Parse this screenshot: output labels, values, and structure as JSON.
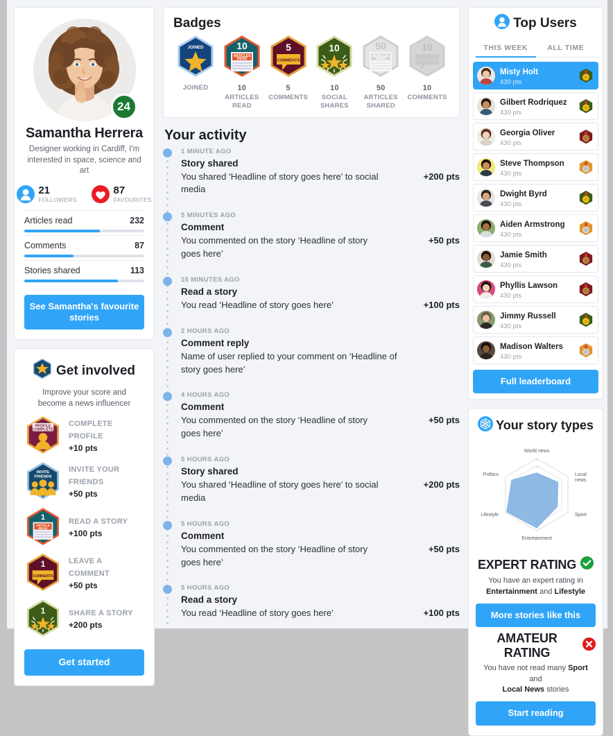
{
  "profile": {
    "name": "Samantha Herrera",
    "bio": "Designer working in Cardiff, I'm interested in space, science and art",
    "level": "24",
    "followers_count": "21",
    "followers_label": "FOLLOWERS",
    "favourites_count": "87",
    "favourites_label": "FAVOURITES",
    "bars": [
      {
        "label": "Articles read",
        "value": "232",
        "percent": 63
      },
      {
        "label": "Comments",
        "value": "87",
        "percent": 41
      },
      {
        "label": "Stories shared",
        "value": "113",
        "percent": 78
      }
    ],
    "cta": "See Samantha's favourite stories"
  },
  "get_involved": {
    "title": "Get involved",
    "subtitle": "Improve your score and become a news influencer",
    "items": [
      {
        "name": "COMPLETE PROFILE",
        "points": "+10 pts",
        "icon": "profile-complete-hex-icon",
        "color": "#7d1c42",
        "border": "#e8a33d",
        "chip": "PROFILE COMPLETE"
      },
      {
        "name": "INVITE YOUR FRIENDS",
        "points": "+50 pts",
        "icon": "invite-friends-hex-icon",
        "color": "#17486e",
        "border": "#9dc4e0",
        "chip": "INVITE FRIENDS"
      },
      {
        "name": "READ A STORY",
        "points": "+100 pts",
        "icon": "read-story-hex-icon",
        "color": "#15616b",
        "border": "#e2592e",
        "chip": "1"
      },
      {
        "name": "LEAVE A COMMENT",
        "points": "+50 pts",
        "icon": "comment-hex-icon",
        "color": "#5e1028",
        "border": "#e8a33d",
        "chip": "1"
      },
      {
        "name": "SHARE A STORY",
        "points": "+200 pts",
        "icon": "share-story-hex-icon",
        "color": "#3c5c18",
        "border": "#d4dba1",
        "chip": "1"
      }
    ],
    "cta": "Get started"
  },
  "badges": {
    "title": "Badges",
    "items": [
      {
        "icon": "joined-star-hex-icon",
        "number": "",
        "caption": "JOINED",
        "fill": "#14447c",
        "border": "#a9cdf0",
        "earned": true,
        "chip": "JOINED"
      },
      {
        "icon": "articles-read-hex-icon",
        "number": "10",
        "caption": "ARTICLES READ",
        "fill": "#15616b",
        "border": "#e2592e",
        "earned": true,
        "chip": "ARTICLES READ"
      },
      {
        "icon": "comments-hex-icon",
        "number": "5",
        "caption": "COMMENTS",
        "fill": "#5e1028",
        "border": "#e8a33d",
        "earned": true,
        "chip": "COMMENTS"
      },
      {
        "icon": "social-shares-hex-icon",
        "number": "10",
        "caption": "SOCIAL SHARES",
        "fill": "#3c5c18",
        "border": "#d4dba1",
        "earned": true,
        "chip": ""
      },
      {
        "icon": "articles-shared-hex-icon",
        "number": "50",
        "caption": "ARTICLES SHARED",
        "fill": "#e4e4e4",
        "border": "#cdcdcd",
        "earned": false,
        "chip": "ARTICLES READ"
      },
      {
        "icon": "comments-locked-hex-icon",
        "number": "10",
        "caption": "COMMENTS",
        "fill": "#d6d6d6",
        "border": "#cdcdcd",
        "earned": false,
        "chip": "COMMENTS"
      }
    ]
  },
  "activity": {
    "title": "Your activity",
    "items": [
      {
        "time": "1 MINUTE AGO",
        "title": "Story shared",
        "desc": "You shared ‘Headline of story goes here’ to social media",
        "points": "+200 pts"
      },
      {
        "time": "5 MINUTES AGO",
        "title": "Comment",
        "desc": "You commented on the story ‘Headline of story goes here’",
        "points": "+50 pts"
      },
      {
        "time": "15 MINUTES AGO",
        "title": "Read a story",
        "desc": "You read ‘Headline of story goes here’",
        "points": "+100 pts"
      },
      {
        "time": "2 HOURS AGO",
        "title": "Comment reply",
        "desc": "Name of user replied to your comment on ‘Headline of story goes here’",
        "points": ""
      },
      {
        "time": "4 HOURS AGO",
        "title": "Comment",
        "desc": "You commented on the story ‘Headline of story goes here’",
        "points": "+50 pts"
      },
      {
        "time": "5 HOURS AGO",
        "title": "Story shared",
        "desc": "You shared ‘Headline of story goes here’ to social media",
        "points": "+200 pts"
      },
      {
        "time": "5 HOURS AGO",
        "title": "Comment",
        "desc": "You commented on the story ‘Headline of story goes here’",
        "points": "+50 pts"
      },
      {
        "time": "5 HOURS AGO",
        "title": "Read a story",
        "desc": "You read ‘Headline of story goes here’",
        "points": "+100 pts"
      }
    ]
  },
  "top_users": {
    "title": "Top Users",
    "tabs": [
      {
        "label": "THIS WEEK",
        "active": true
      },
      {
        "label": "ALL TIME",
        "active": false
      }
    ],
    "users": [
      {
        "name": "Misty Holt",
        "points": "430 pts",
        "medal": "gold-medal-hex-icon",
        "medal_hex": "#3c5c18",
        "medal_disc": "#f0c419",
        "active": true,
        "skin": "#f0c9a8",
        "hair": "#4a2c18"
      },
      {
        "name": "Gilbert Rodriquez",
        "points": "430 pts",
        "medal": "gold-medal-hex-icon",
        "medal_hex": "#3c5c18",
        "medal_disc": "#f0c419",
        "active": false,
        "skin": "#c98c5a",
        "hair": "#24160c"
      },
      {
        "name": "Georgia Oliver",
        "points": "430 pts",
        "medal": "bronze-medal-hex-icon",
        "medal_hex": "#7d1c1c",
        "medal_disc": "#c08a4a",
        "active": false,
        "skin": "#f3d2b6",
        "hair": "#5a3420"
      },
      {
        "name": "Steve Thompson",
        "points": "430 pts",
        "medal": "silver-medal-hex-icon",
        "medal_hex": "#e0962c",
        "medal_disc": "#d5d5d5",
        "active": false,
        "skin": "#c98c5a",
        "hair": "#1a1208"
      },
      {
        "name": "Dwight Byrd",
        "points": "430 pts",
        "medal": "gold-medal-hex-icon",
        "medal_hex": "#3c5c18",
        "medal_disc": "#f0c419",
        "active": false,
        "skin": "#dba87c",
        "hair": "#2e2118"
      },
      {
        "name": "Aiden Armstrong",
        "points": "430 pts",
        "medal": "silver-medal-hex-icon",
        "medal_hex": "#e0962c",
        "medal_disc": "#d5d5d5",
        "active": false,
        "skin": "#a9713f",
        "hair": "#1a1208"
      },
      {
        "name": "Jamie Smith",
        "points": "430 pts",
        "medal": "bronze-medal-hex-icon",
        "medal_hex": "#7d1c1c",
        "medal_disc": "#c08a4a",
        "active": false,
        "skin": "#8a5a32",
        "hair": "#161008"
      },
      {
        "name": "Phyllis Lawson",
        "points": "430 pts",
        "medal": "bronze-medal-hex-icon",
        "medal_hex": "#7d1c1c",
        "medal_disc": "#c08a4a",
        "active": false,
        "skin": "#f3d2b6",
        "hair": "#1f1410"
      },
      {
        "name": "Jimmy Russell",
        "points": "430 pts",
        "medal": "gold-medal-hex-icon",
        "medal_hex": "#3c5c18",
        "medal_disc": "#f0c419",
        "active": false,
        "skin": "#e8c0a0",
        "hair": "#6b5a42"
      },
      {
        "name": "Madison Walters",
        "points": "430 pts",
        "medal": "silver-medal-hex-icon",
        "medal_hex": "#e0962c",
        "medal_disc": "#d5d5d5",
        "active": false,
        "skin": "#8a5a32",
        "hair": "#14100c"
      }
    ],
    "cta": "Full leaderboard"
  },
  "story_types": {
    "title": "Your story types",
    "expert": {
      "heading": "EXPERT RATING",
      "status_icon": "check-circle-icon",
      "status_color": "#1b9e3e",
      "desc_before": "You have an expert rating in",
      "desc_bold1": "Entertainment",
      "desc_mid": "and",
      "desc_bold2": "Lifestyle",
      "cta": "More stories like this"
    },
    "amateur": {
      "heading": "AMATEUR RATING",
      "status_icon": "x-circle-icon",
      "status_color": "#e01b1b",
      "desc_before": "You have not read many",
      "desc_bold1": "Sport",
      "desc_mid": "and",
      "desc_bold2": "Local News",
      "desc_after": "stories",
      "cta": "Start reading"
    }
  },
  "chart_data": {
    "type": "radar",
    "title": "Your story types",
    "categories": [
      "World news",
      "Local news",
      "Sport",
      "Entertainment",
      "Lifestyle",
      "Politics"
    ],
    "values": [
      3.0,
      3.4,
      3.3,
      4.6,
      4.8,
      4.0
    ],
    "rlim": [
      0,
      5
    ],
    "tick_labels": [
      "0",
      "1",
      "2",
      "3",
      "4",
      "5"
    ],
    "grid": true,
    "legend": "none",
    "fill_color": "#7fb0e0",
    "grid_color": "#d8dce3"
  },
  "colors": {
    "accent": "#30a5f7",
    "page_bg": "#f2f4f8",
    "card_bg": "#ffffff",
    "text": "#1c1f24",
    "muted": "#9aa1ab",
    "level_green": "#1b7a32",
    "heart_red": "#ed1c24"
  }
}
